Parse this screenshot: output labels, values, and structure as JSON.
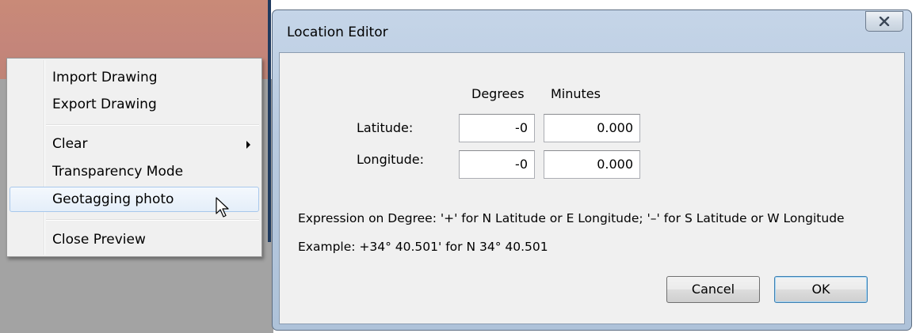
{
  "context_menu": {
    "items": [
      {
        "label": "Import Drawing"
      },
      {
        "label": "Export Drawing"
      },
      {
        "label": "Clear"
      },
      {
        "label": "Transparency Mode"
      },
      {
        "label": "Geotagging photo"
      },
      {
        "label": "Close Preview"
      }
    ],
    "hovered_item": "Geotagging photo"
  },
  "dialog": {
    "title": "Location Editor",
    "columns": {
      "degrees": "Degrees",
      "minutes": "Minutes"
    },
    "rows": [
      {
        "label": "Latitude:",
        "degrees": "-0",
        "minutes": "0.000"
      },
      {
        "label": "Longitude:",
        "degrees": "-0",
        "minutes": "0.000"
      }
    ],
    "expression_text": "Expression on Degree: '+' for N Latitude or E Longitude; '–' for S Latitude or W Longitude",
    "example_text": "Example: +34° 40.501'  for  N 34° 40.501",
    "buttons": {
      "cancel": "Cancel",
      "ok": "OK"
    }
  },
  "colors": {
    "dialog_frame": "#b8cadf",
    "menu_highlight": "#e4eef9",
    "default_button_border": "#3c7fb1"
  },
  "icons": {
    "close": "close-icon",
    "submenu": "chevron-right-icon",
    "cursor": "arrow-cursor-icon"
  }
}
